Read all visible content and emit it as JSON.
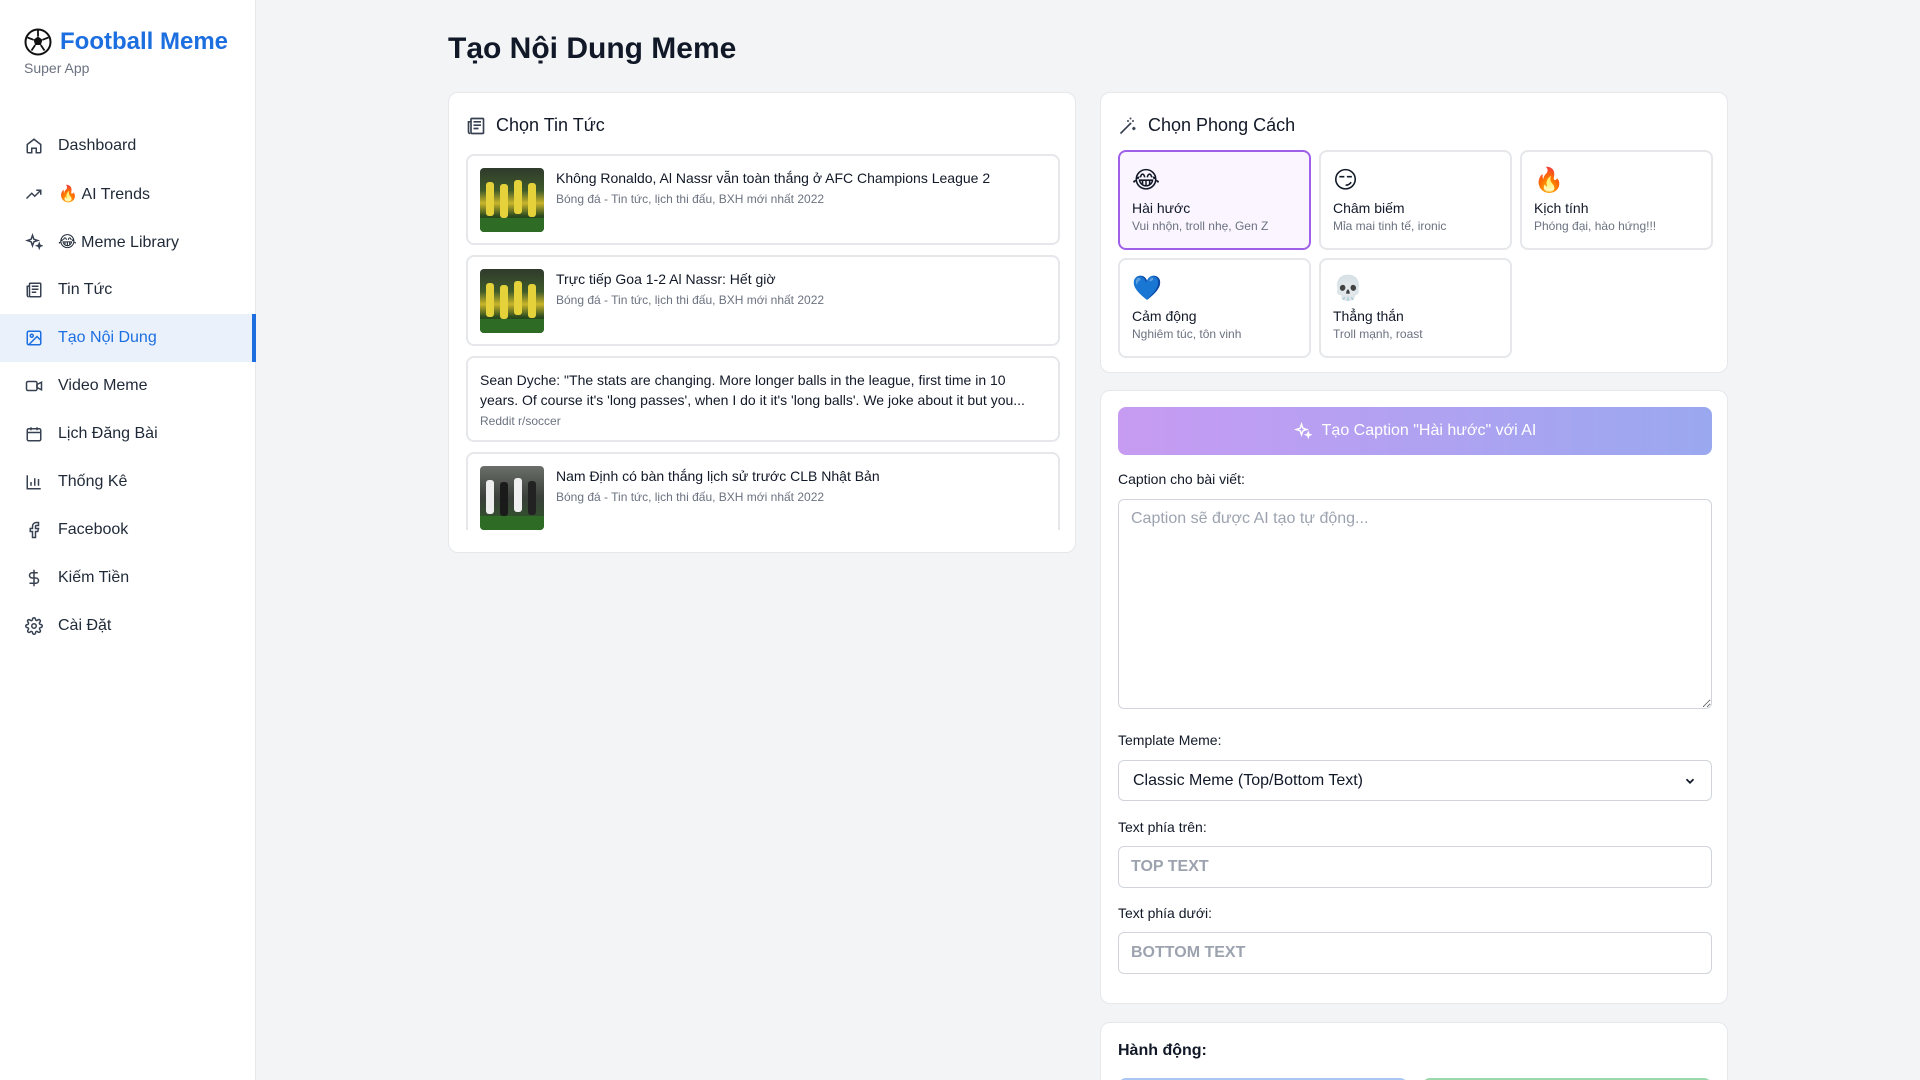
{
  "brand": {
    "title": "Football Meme",
    "subtitle": "Super App"
  },
  "sidebar": {
    "items": [
      {
        "label": "Dashboard",
        "icon": "home-icon"
      },
      {
        "label": "AI Trends",
        "icon": "trending-up-icon",
        "emoji": "🔥"
      },
      {
        "label": "Meme Library",
        "icon": "sparkles-icon",
        "emoji": "😂"
      },
      {
        "label": "Tin Tức",
        "icon": "newspaper-icon"
      },
      {
        "label": "Tạo Nội Dung",
        "icon": "image-icon",
        "active": true
      },
      {
        "label": "Video Meme",
        "icon": "video-icon"
      },
      {
        "label": "Lịch Đăng Bài",
        "icon": "calendar-icon"
      },
      {
        "label": "Thống Kê",
        "icon": "bar-chart-icon"
      },
      {
        "label": "Facebook",
        "icon": "facebook-icon"
      },
      {
        "label": "Kiếm Tiền",
        "icon": "dollar-icon"
      },
      {
        "label": "Cài Đặt",
        "icon": "gear-icon"
      }
    ]
  },
  "page": {
    "title": "Tạo Nội Dung Meme"
  },
  "news": {
    "heading": "Chọn Tin Tức",
    "items": [
      {
        "title": "Không Ronaldo, Al Nassr vẫn toàn thắng ở AFC Champions League 2",
        "meta": "Bóng đá - Tin tức, lịch thi đấu, BXH mới nhất 2022"
      },
      {
        "title": "Trực tiếp Goa 1-2 Al Nassr: Hết giờ",
        "meta": "Bóng đá - Tin tức, lịch thi đấu, BXH mới nhất 2022"
      },
      {
        "title": "Sean Dyche: \"The stats are changing. More longer balls in the league, first time in 10 years. Of course it's 'long passes', when I do it it's 'long balls'. We joke about it but you...",
        "meta": "Reddit r/soccer"
      },
      {
        "title": "Nam Định có bàn thắng lịch sử trước CLB Nhật Bản",
        "meta": "Bóng đá - Tin tức, lịch thi đấu, BXH mới nhất 2022"
      }
    ]
  },
  "style": {
    "heading": "Chọn Phong Cách",
    "options": [
      {
        "emoji": "😂",
        "name": "Hài hước",
        "desc": "Vui nhộn, troll nhẹ, Gen Z",
        "selected": true
      },
      {
        "emoji": "😏",
        "name": "Châm biếm",
        "desc": "Mỉa mai tinh tế, ironic"
      },
      {
        "emoji": "🔥",
        "name": "Kịch tính",
        "desc": "Phóng đại, hào hứng!!!"
      },
      {
        "emoji": "💙",
        "name": "Cảm động",
        "desc": "Nghiêm túc, tôn vinh"
      },
      {
        "emoji": "💀",
        "name": "Thẳng thắn",
        "desc": "Troll mạnh, roast"
      }
    ]
  },
  "form": {
    "generate_label": "Tạo Caption \"Hài hước\" với AI",
    "caption_label": "Caption cho bài viết:",
    "caption_placeholder": "Caption sẽ được AI tạo tự động...",
    "template_label": "Template Meme:",
    "template_value": "Classic Meme (Top/Bottom Text)",
    "top_label": "Text phía trên:",
    "top_placeholder": "TOP TEXT",
    "bottom_label": "Text phía dưới:",
    "bottom_placeholder": "BOTTOM TEXT"
  },
  "actions": {
    "heading": "Hành động:"
  },
  "colors": {
    "accent": "#1d6fe0",
    "selected_border": "#9f5fe9"
  }
}
